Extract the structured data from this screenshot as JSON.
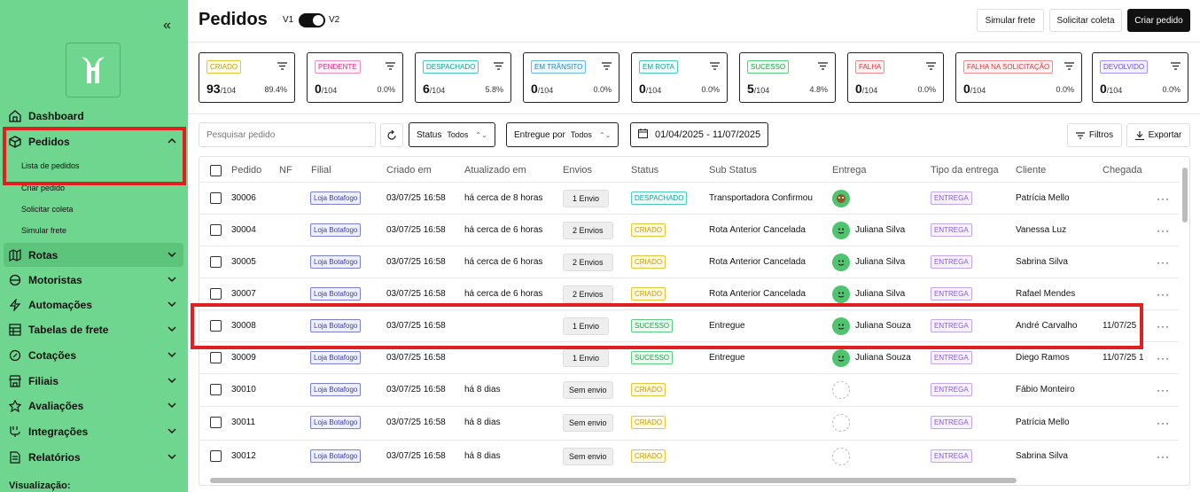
{
  "sidebar": {
    "items": [
      {
        "label": "Dashboard",
        "icon": "home-icon"
      },
      {
        "label": "Pedidos",
        "icon": "box-icon"
      },
      {
        "label": "Rotas",
        "icon": "map-icon"
      },
      {
        "label": "Motoristas",
        "icon": "steering-icon"
      },
      {
        "label": "Automações",
        "icon": "bolt-icon"
      },
      {
        "label": "Tabelas de frete",
        "icon": "table-icon"
      },
      {
        "label": "Cotações",
        "icon": "percent-icon"
      },
      {
        "label": "Filiais",
        "icon": "store-icon"
      },
      {
        "label": "Avaliações",
        "icon": "star-icon"
      },
      {
        "label": "Integrações",
        "icon": "plug-icon"
      },
      {
        "label": "Relatórios",
        "icon": "report-icon"
      }
    ],
    "subitems": [
      "Lista de pedidos",
      "Criar pedido",
      "Solicitar coleta",
      "Simular frete"
    ],
    "footer": "Visualização:"
  },
  "header": {
    "title": "Pedidos",
    "v1": "V1",
    "v2": "V2",
    "buttons": {
      "simular": "Simular frete",
      "coleta": "Solicitar coleta",
      "criar": "Criar pedido"
    }
  },
  "status_cards": [
    {
      "label": "CRIADO",
      "count": "93",
      "total": "/104",
      "pct": "89.4%",
      "color": "#e7c53b"
    },
    {
      "label": "PENDENTE",
      "count": "0",
      "total": "/104",
      "pct": "0.0%",
      "color": "#ee8fbf"
    },
    {
      "label": "DESPACHADO",
      "count": "6",
      "total": "/104",
      "pct": "5.8%",
      "color": "#4dc9bd"
    },
    {
      "label": "EM TRÂNSITO",
      "count": "0",
      "total": "/104",
      "pct": "0.0%",
      "color": "#6fb8e6"
    },
    {
      "label": "EM ROTA",
      "count": "0",
      "total": "/104",
      "pct": "0.0%",
      "color": "#4dc9bd"
    },
    {
      "label": "SUCESSO",
      "count": "5",
      "total": "/104",
      "pct": "4.8%",
      "color": "#5ccf7f"
    },
    {
      "label": "FALHA",
      "count": "0",
      "total": "/104",
      "pct": "0.0%",
      "color": "#f08a8f"
    },
    {
      "label": "FALHA NA SOLICITAÇÃO",
      "count": "0",
      "total": "/104",
      "pct": "0.0%",
      "color": "#f08a8f"
    },
    {
      "label": "DEVOLVIDO",
      "count": "0",
      "total": "/104",
      "pct": "0.0%",
      "color": "#a893ee"
    }
  ],
  "filters": {
    "search_placeholder": "Pesquisar pedido",
    "status_label": "Status",
    "status_value": "Todos",
    "entregue_label": "Entregue por",
    "entregue_value": "Todos",
    "date_range": "01/04/2025 - 11/07/2025",
    "filtros": "Filtros",
    "exportar": "Exportar"
  },
  "table": {
    "headers": [
      "Pedido",
      "NF",
      "Filial",
      "Criado em",
      "Atualizado em",
      "Envios",
      "Status",
      "Sub Status",
      "Entrega",
      "Tipo da entrega",
      "Cliente",
      "Chegada"
    ],
    "rows": [
      {
        "pedido": "30006",
        "filial": "Loja Botafogo",
        "criado": "03/07/25 16:58",
        "atualizado": "há cerca de 8 horas",
        "envios": "1 Envio",
        "status": "DESPACHADO",
        "substatus": "Transportadora Confirmou",
        "entrega": "",
        "tipo": "ENTREGA",
        "cliente": "Patrícia Mello",
        "chegada": ""
      },
      {
        "pedido": "30004",
        "filial": "Loja Botafogo",
        "criado": "03/07/25 16:58",
        "atualizado": "há cerca de 6 horas",
        "envios": "2 Envios",
        "status": "CRIADO",
        "substatus": "Rota Anterior Cancelada",
        "entrega": "Juliana Silva",
        "tipo": "ENTREGA",
        "cliente": "Vanessa Luz",
        "chegada": ""
      },
      {
        "pedido": "30005",
        "filial": "Loja Botafogo",
        "criado": "03/07/25 16:58",
        "atualizado": "há cerca de 6 horas",
        "envios": "2 Envios",
        "status": "CRIADO",
        "substatus": "Rota Anterior Cancelada",
        "entrega": "Juliana Silva",
        "tipo": "ENTREGA",
        "cliente": "Sabrina Silva",
        "chegada": ""
      },
      {
        "pedido": "30007",
        "filial": "Loja Botafogo",
        "criado": "03/07/25 16:58",
        "atualizado": "há cerca de 6 horas",
        "envios": "2 Envios",
        "status": "CRIADO",
        "substatus": "Rota Anterior Cancelada",
        "entrega": "Juliana Silva",
        "tipo": "ENTREGA",
        "cliente": "Rafael Mendes",
        "chegada": ""
      },
      {
        "pedido": "30008",
        "filial": "Loja Botafogo",
        "criado": "03/07/25 16:58",
        "atualizado": "",
        "envios": "1 Envio",
        "status": "SUCESSO",
        "substatus": "Entregue",
        "entrega": "Juliana Souza",
        "tipo": "ENTREGA",
        "cliente": "André Carvalho",
        "chegada": "11/07/25"
      },
      {
        "pedido": "30009",
        "filial": "Loja Botafogo",
        "criado": "03/07/25 16:58",
        "atualizado": "",
        "envios": "1 Envio",
        "status": "SUCESSO",
        "substatus": "Entregue",
        "entrega": "Juliana Souza",
        "tipo": "ENTREGA",
        "cliente": "Diego Ramos",
        "chegada": "11/07/25 1"
      },
      {
        "pedido": "30010",
        "filial": "Loja Botafogo",
        "criado": "03/07/25 16:58",
        "atualizado": "há 8 dias",
        "envios": "Sem envio",
        "status": "CRIADO",
        "substatus": "",
        "entrega": "",
        "tipo": "ENTREGA",
        "cliente": "Fábio Monteiro",
        "chegada": ""
      },
      {
        "pedido": "30011",
        "filial": "Loja Botafogo",
        "criado": "03/07/25 16:58",
        "atualizado": "há 8 dias",
        "envios": "Sem envio",
        "status": "CRIADO",
        "substatus": "",
        "entrega": "",
        "tipo": "ENTREGA",
        "cliente": "Patrícia Mello",
        "chegada": ""
      },
      {
        "pedido": "30012",
        "filial": "Loja Botafogo",
        "criado": "03/07/25 16:58",
        "atualizado": "há 8 dias",
        "envios": "Sem envio",
        "status": "CRIADO",
        "substatus": "",
        "entrega": "",
        "tipo": "ENTREGA",
        "cliente": "Sabrina Silva",
        "chegada": ""
      }
    ]
  }
}
